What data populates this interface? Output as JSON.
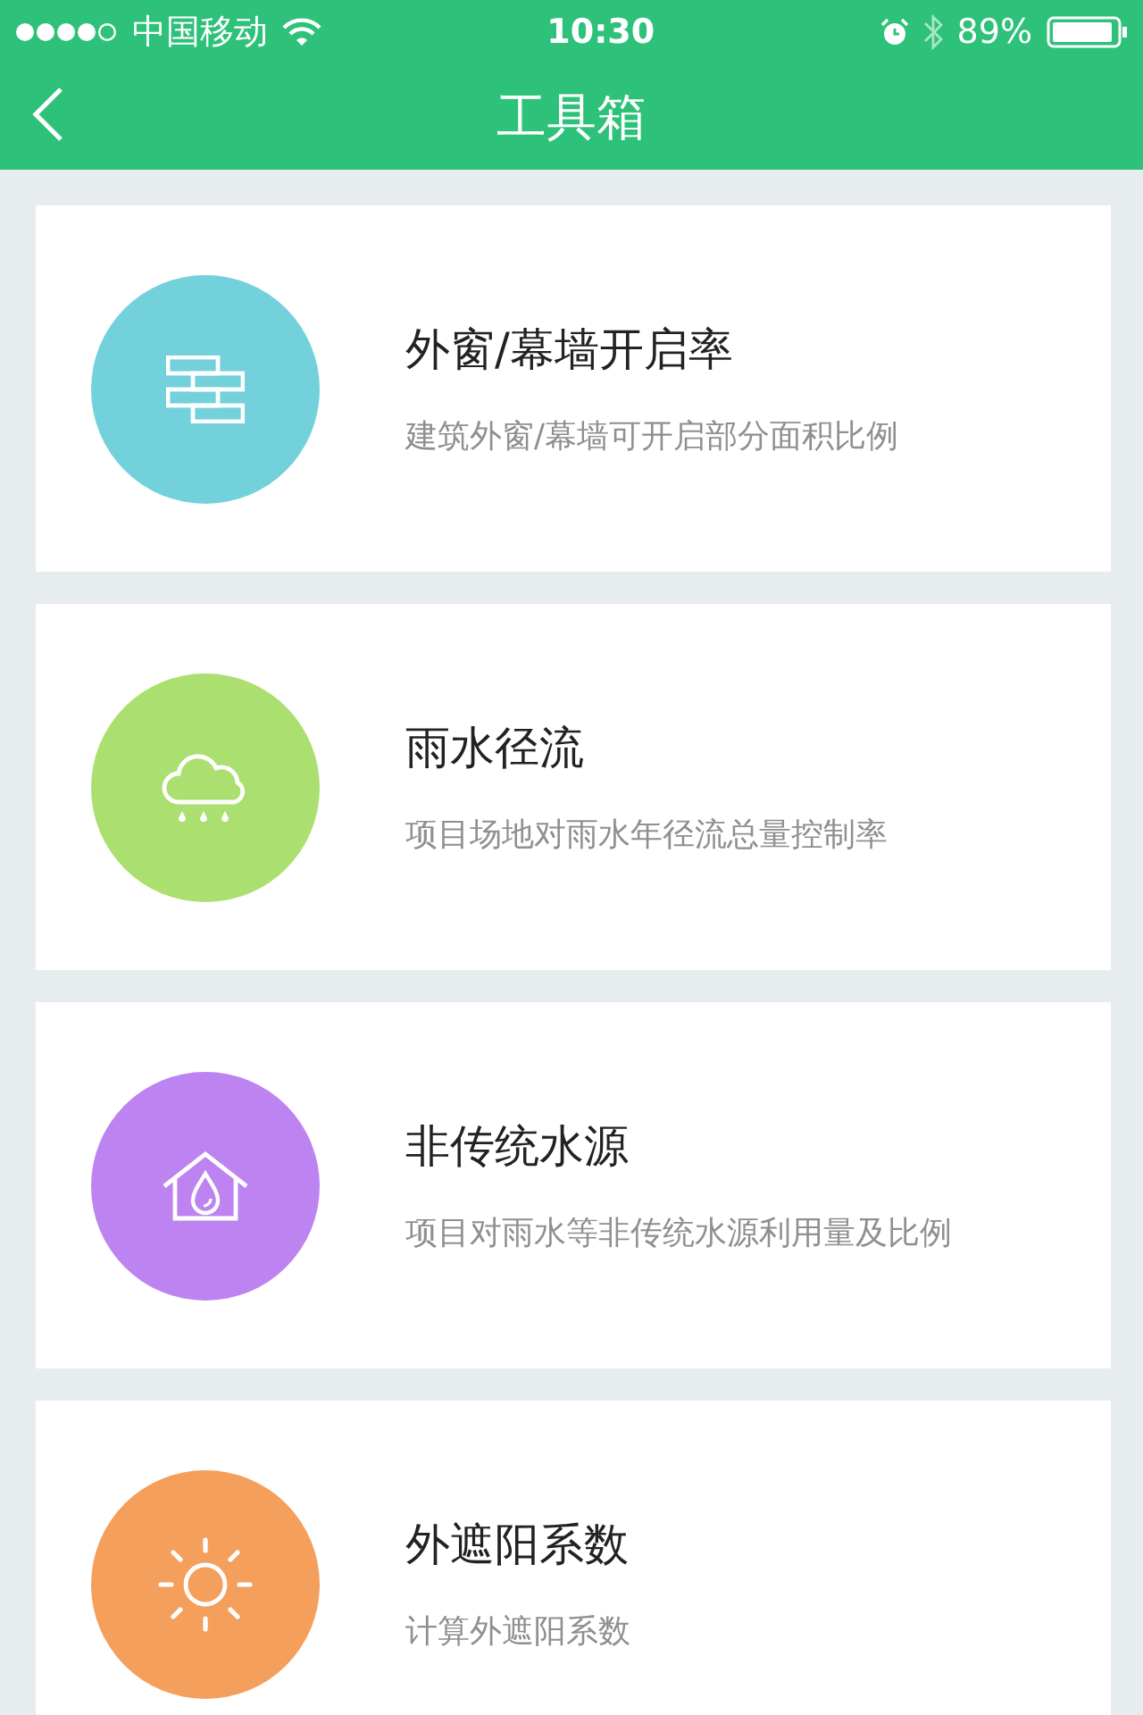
{
  "status_bar": {
    "carrier": "中国移动",
    "time": "10:30",
    "battery": "89%"
  },
  "nav": {
    "title": "工具箱"
  },
  "tools": [
    {
      "kind": "brick",
      "color": "#72d1db",
      "title": "外窗/幕墙开启率",
      "subtitle": "建筑外窗/幕墙可开启部分面积比例"
    },
    {
      "kind": "rain",
      "color": "#abdf6f",
      "title": "雨水径流",
      "subtitle": "项目场地对雨水年径流总量控制率"
    },
    {
      "kind": "house",
      "color": "#bd83f1",
      "title": "非传统水源",
      "subtitle": "项目对雨水等非传统水源利用量及比例"
    },
    {
      "kind": "sun",
      "color": "#f59f5c",
      "title": "外遮阳系数",
      "subtitle": "计算外遮阳系数"
    }
  ]
}
